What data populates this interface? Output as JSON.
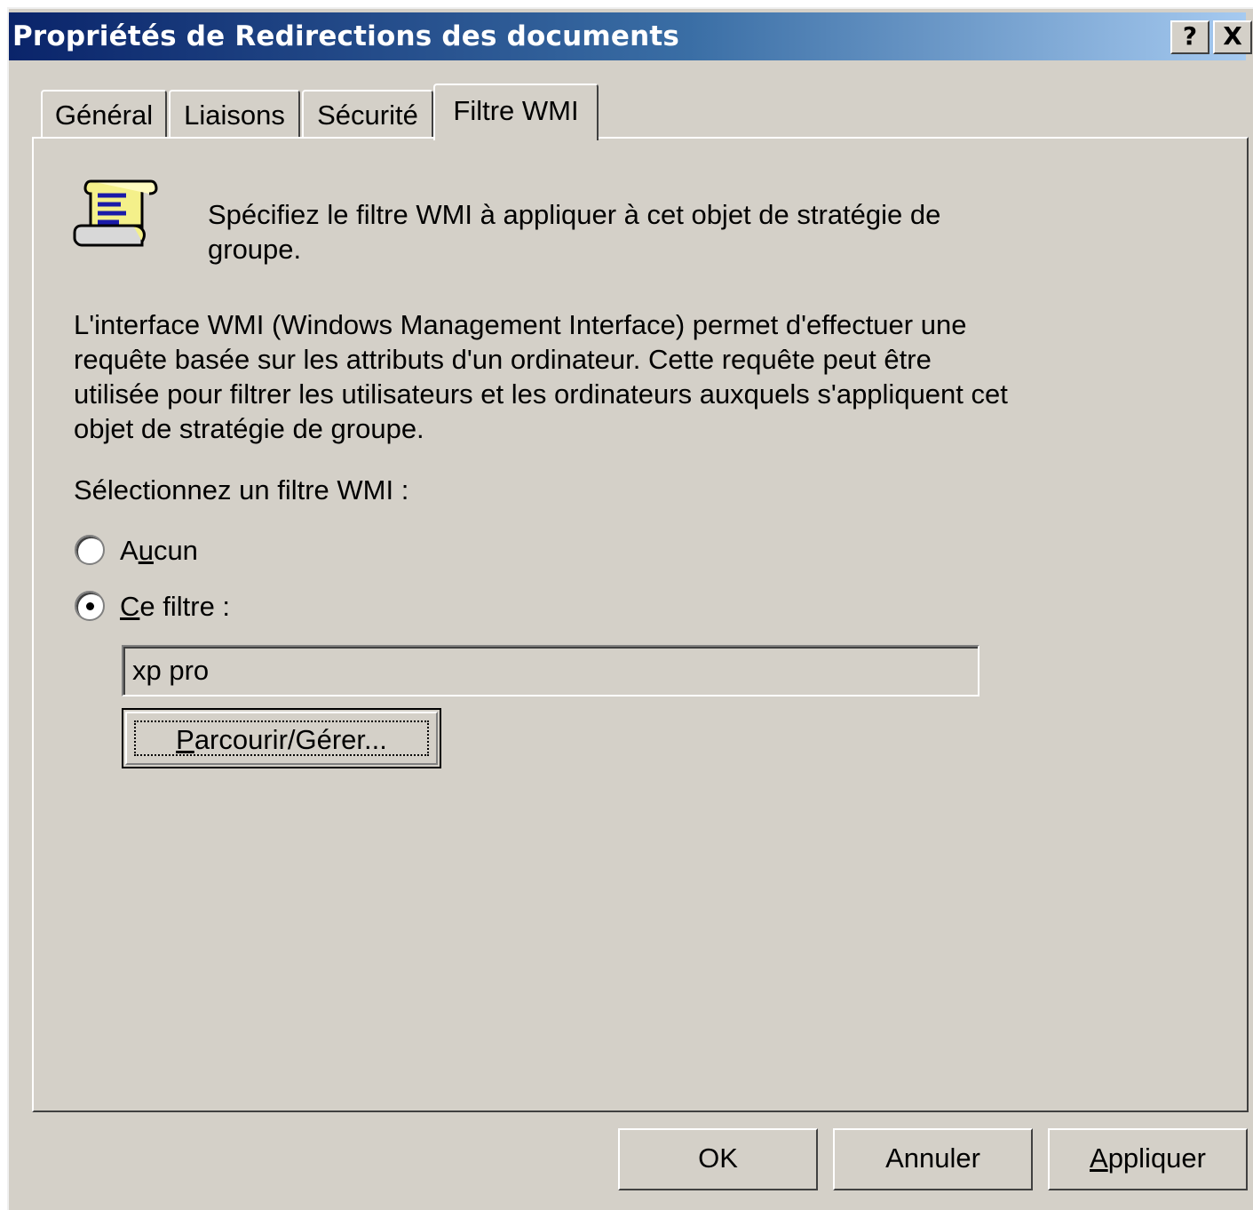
{
  "window": {
    "title": "Propriétés de Redirections des documents",
    "help_button": "?",
    "close_button": "X"
  },
  "tabs": [
    {
      "label": "Général",
      "active": false
    },
    {
      "label": "Liaisons",
      "active": false
    },
    {
      "label": "Sécurité",
      "active": false
    },
    {
      "label": "Filtre WMI",
      "active": true
    }
  ],
  "panel": {
    "header_icon": "scroll-icon",
    "header_text": "Spécifiez le filtre WMI à appliquer à cet objet de stratégie de groupe.",
    "description": "L'interface WMI (Windows Management Interface) permet d'effectuer une requête basée sur les attributs d'un ordinateur. Cette requête peut être utilisée pour filtrer les utilisateurs et les ordinateurs auxquels s'appliquent cet objet de stratégie de groupe.",
    "select_label": "Sélectionnez un filtre WMI :",
    "options": [
      {
        "label_pre": "A",
        "label_accel": "u",
        "label_post": "cun",
        "selected": false
      },
      {
        "label_pre": "",
        "label_accel": "C",
        "label_post": "e filtre :",
        "selected": true
      }
    ],
    "filter_value": "xp pro",
    "browse_button": {
      "accel": "P",
      "rest": "arcourir/Gérer..."
    }
  },
  "footer": {
    "ok": "OK",
    "cancel": "Annuler",
    "apply": {
      "accel": "A",
      "rest": "ppliquer"
    }
  }
}
